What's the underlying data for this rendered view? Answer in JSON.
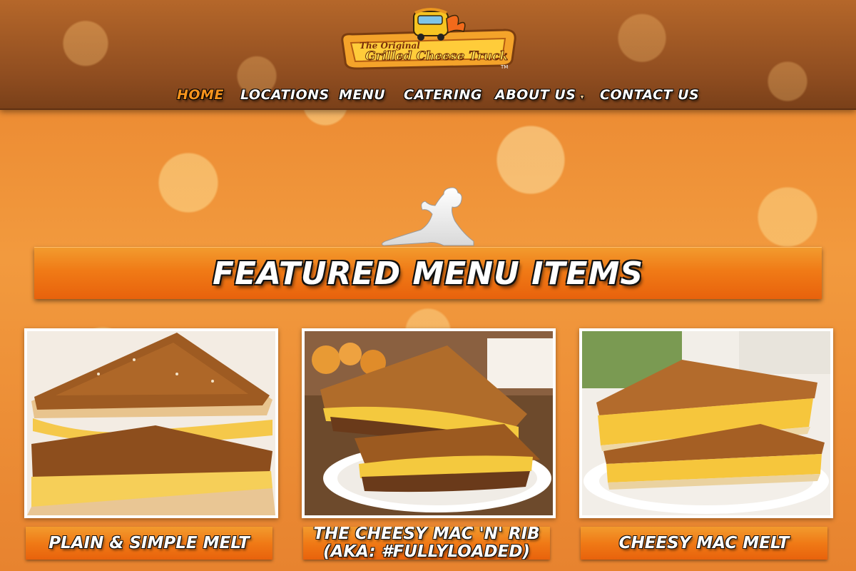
{
  "header": {
    "logo": {
      "line1": "The Original",
      "line2": "Grilled Cheese Truck",
      "mark": "TM"
    },
    "nav": [
      {
        "label": "HOME",
        "active": true
      },
      {
        "label": "LOCATIONS",
        "active": false
      },
      {
        "label": "MENU",
        "active": false
      },
      {
        "label": "CATERING",
        "active": false
      },
      {
        "label": "ABOUT US",
        "active": false,
        "dropdown": true
      },
      {
        "label": "CONTACT US",
        "active": false
      }
    ],
    "dropdown_icon": "chevron-down-icon"
  },
  "featured": {
    "title": "FEATURED MENU ITEMS",
    "mascot_icon": "reclining-woman-silhouette-icon",
    "items": [
      {
        "name": "PLAIN & SIMPLE MELT",
        "image": "plain-simple-melt-photo"
      },
      {
        "name_line1": "THE CHEESY MAC 'N' RIB",
        "name_line2": "(AKA: #FULLYLOADED)",
        "image": "cheesy-mac-n-rib-photo"
      },
      {
        "name": "CHEESY MAC MELT",
        "image": "cheesy-mac-melt-photo"
      }
    ]
  },
  "colors": {
    "accent_orange": "#f07a16",
    "active_nav": "#f7941d",
    "header_brown": "#8f4d20"
  }
}
